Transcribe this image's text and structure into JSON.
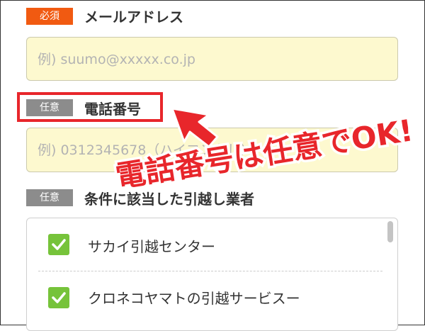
{
  "email_section": {
    "badge": "必須",
    "label": "メールアドレス",
    "placeholder": "例) suumo@xxxxx.co.jp"
  },
  "phone_section": {
    "badge": "任意",
    "label": "電話番号",
    "placeholder": "例) 0312345678（ハイフンなし）"
  },
  "annotation": {
    "text": "電話番号は任意でOK!",
    "color": "#e8262b"
  },
  "movers_section": {
    "badge": "任意",
    "label": "条件に該当した引越し業者",
    "items": [
      {
        "label": "サカイ引越センター",
        "checked": true
      },
      {
        "label": "クロネコヤマトの引越サービスー",
        "checked": true
      }
    ]
  },
  "colors": {
    "required_badge": "#f15a11",
    "optional_badge": "#8c8c8c",
    "input_bg": "#fdf9cf",
    "checkbox": "#76c33a"
  }
}
